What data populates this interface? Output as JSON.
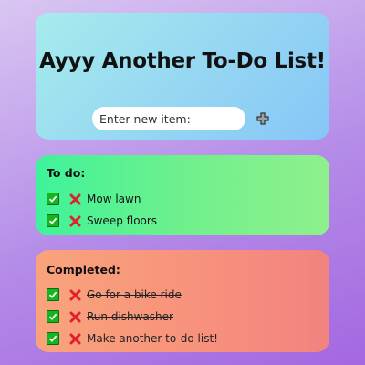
{
  "header": {
    "title": "Ayyy Another To-Do List!",
    "input_placeholder": "Enter new item:",
    "add_icon": "plus-icon"
  },
  "todo": {
    "label": "To do:",
    "items": [
      {
        "text": "Mow lawn"
      },
      {
        "text": "Sweep floors"
      }
    ]
  },
  "completed": {
    "label": "Completed:",
    "items": [
      {
        "text": "Go for a bike ride"
      },
      {
        "text": "Run dishwasher"
      },
      {
        "text": "Make another to-do list!"
      }
    ]
  },
  "colors": {
    "check_green": "#14b51e",
    "delete_red": "#e0202a",
    "header_bg": "#95d6f2",
    "todo_bg": "#6ff08c",
    "completed_bg": "#f7907c"
  },
  "icons": {
    "complete": "check-icon",
    "delete": "cross-icon"
  }
}
